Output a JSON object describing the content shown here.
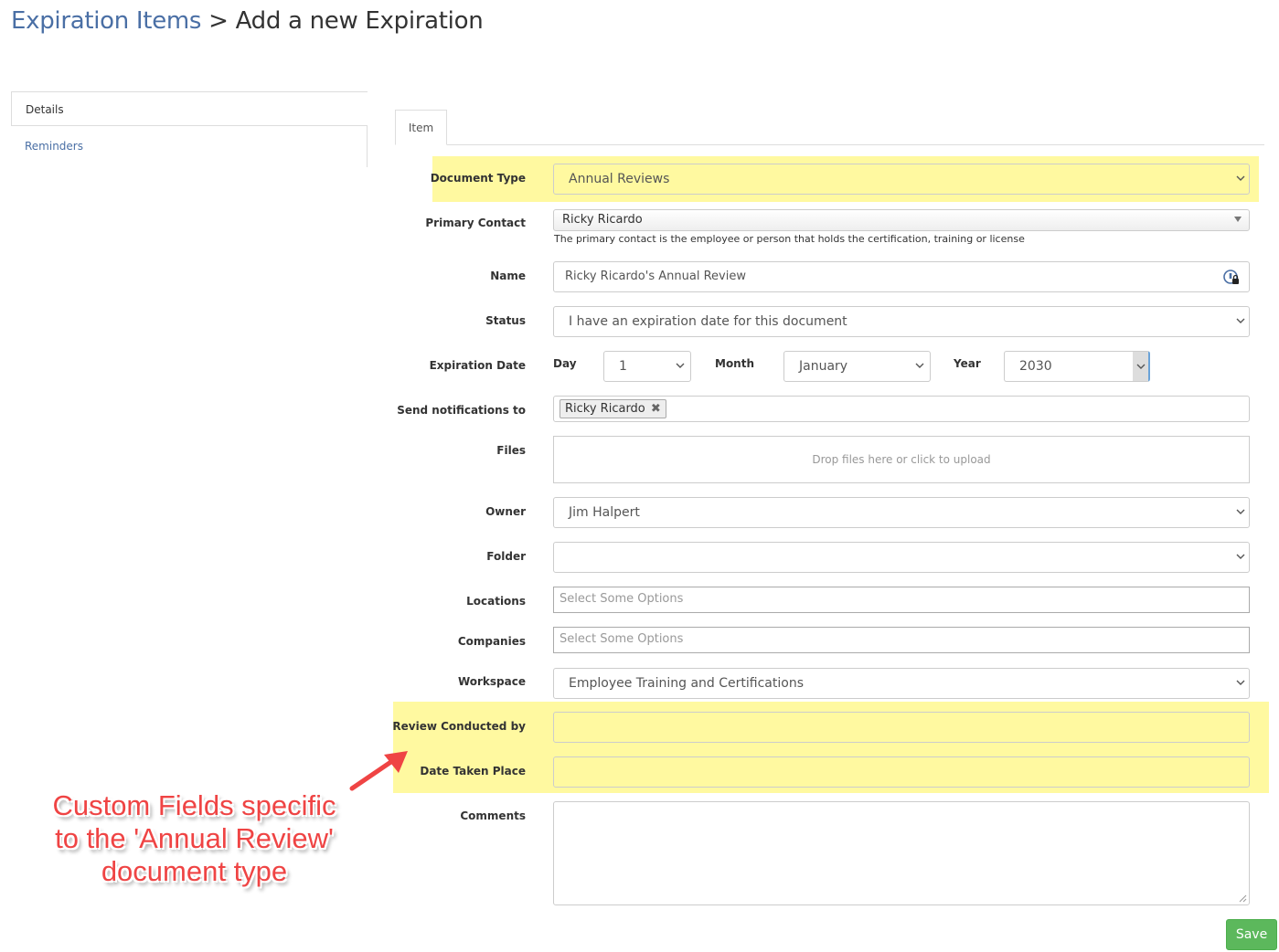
{
  "breadcrumb": {
    "parent": "Expiration Items",
    "separator": ">",
    "current": "Add a new Expiration"
  },
  "sidebar": {
    "items": [
      {
        "label": "Details"
      },
      {
        "label": "Reminders"
      }
    ]
  },
  "tabs": [
    {
      "label": "Item"
    }
  ],
  "form": {
    "document_type": {
      "label": "Document Type",
      "value": "Annual Reviews"
    },
    "primary_contact": {
      "label": "Primary Contact",
      "value": "Ricky Ricardo",
      "help": "The primary contact is the employee or person that holds the certification, training or license"
    },
    "name": {
      "label": "Name",
      "value": "Ricky Ricardo's Annual Review"
    },
    "status": {
      "label": "Status",
      "value": "I have an expiration date for this document"
    },
    "expiration_date": {
      "label": "Expiration Date",
      "day_label": "Day",
      "day_value": "1",
      "month_label": "Month",
      "month_value": "January",
      "year_label": "Year",
      "year_value": "2030"
    },
    "notifications": {
      "label": "Send notifications to",
      "tags": [
        "Ricky Ricardo"
      ]
    },
    "files": {
      "label": "Files",
      "dropzone": "Drop files here or click to upload"
    },
    "owner": {
      "label": "Owner",
      "value": "Jim Halpert"
    },
    "folder": {
      "label": "Folder",
      "value": ""
    },
    "locations": {
      "label": "Locations",
      "placeholder": "Select Some Options"
    },
    "companies": {
      "label": "Companies",
      "placeholder": "Select Some Options"
    },
    "workspace": {
      "label": "Workspace",
      "value": "Employee Training and Certifications"
    },
    "review_conducted_by": {
      "label": "Review Conducted by",
      "value": ""
    },
    "date_taken_place": {
      "label": "Date Taken Place",
      "value": ""
    },
    "comments": {
      "label": "Comments",
      "value": ""
    },
    "save_label": "Save"
  },
  "annotation": {
    "line1": "Custom Fields specific",
    "line2": "to the 'Annual Review'",
    "line3": "document type"
  },
  "colors": {
    "highlight": "#fff9a0",
    "link": "#4a6fa5",
    "save": "#5cb85c",
    "annotation": "#ef4444"
  }
}
